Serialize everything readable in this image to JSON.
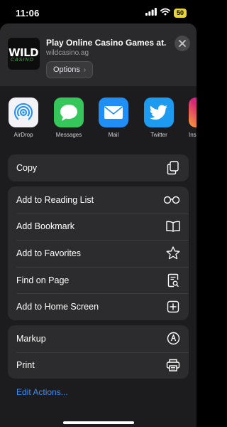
{
  "status_bar": {
    "time": "11:06",
    "battery": "50"
  },
  "header": {
    "title": "Play Online Casino Games at...",
    "url": "wildcasino.ag",
    "options_label": "Options",
    "thumb_word": "WILD",
    "thumb_sub": "CASINO"
  },
  "apps": [
    {
      "label": "AirDrop",
      "icon": "airdrop-icon",
      "color": "#f2f2f7"
    },
    {
      "label": "Messages",
      "icon": "messages-icon",
      "color": "#35c759"
    },
    {
      "label": "Mail",
      "icon": "mail-icon",
      "color": "#1f8ff5"
    },
    {
      "label": "Twitter",
      "icon": "twitter-icon",
      "color": "#1d9bf0"
    },
    {
      "label": "Ins",
      "icon": "instagram-icon",
      "color": "#d62976"
    }
  ],
  "actions": {
    "copy": "Copy",
    "reading_list": "Add to Reading List",
    "bookmark": "Add Bookmark",
    "favorites": "Add to Favorites",
    "find_on_page": "Find on Page",
    "home_screen": "Add to Home Screen",
    "markup": "Markup",
    "print": "Print"
  },
  "edit_actions": "Edit Actions...",
  "colors": {
    "accent": "#3b8cf5",
    "sheet": "#1c1c1e",
    "group": "#2c2c2e"
  }
}
